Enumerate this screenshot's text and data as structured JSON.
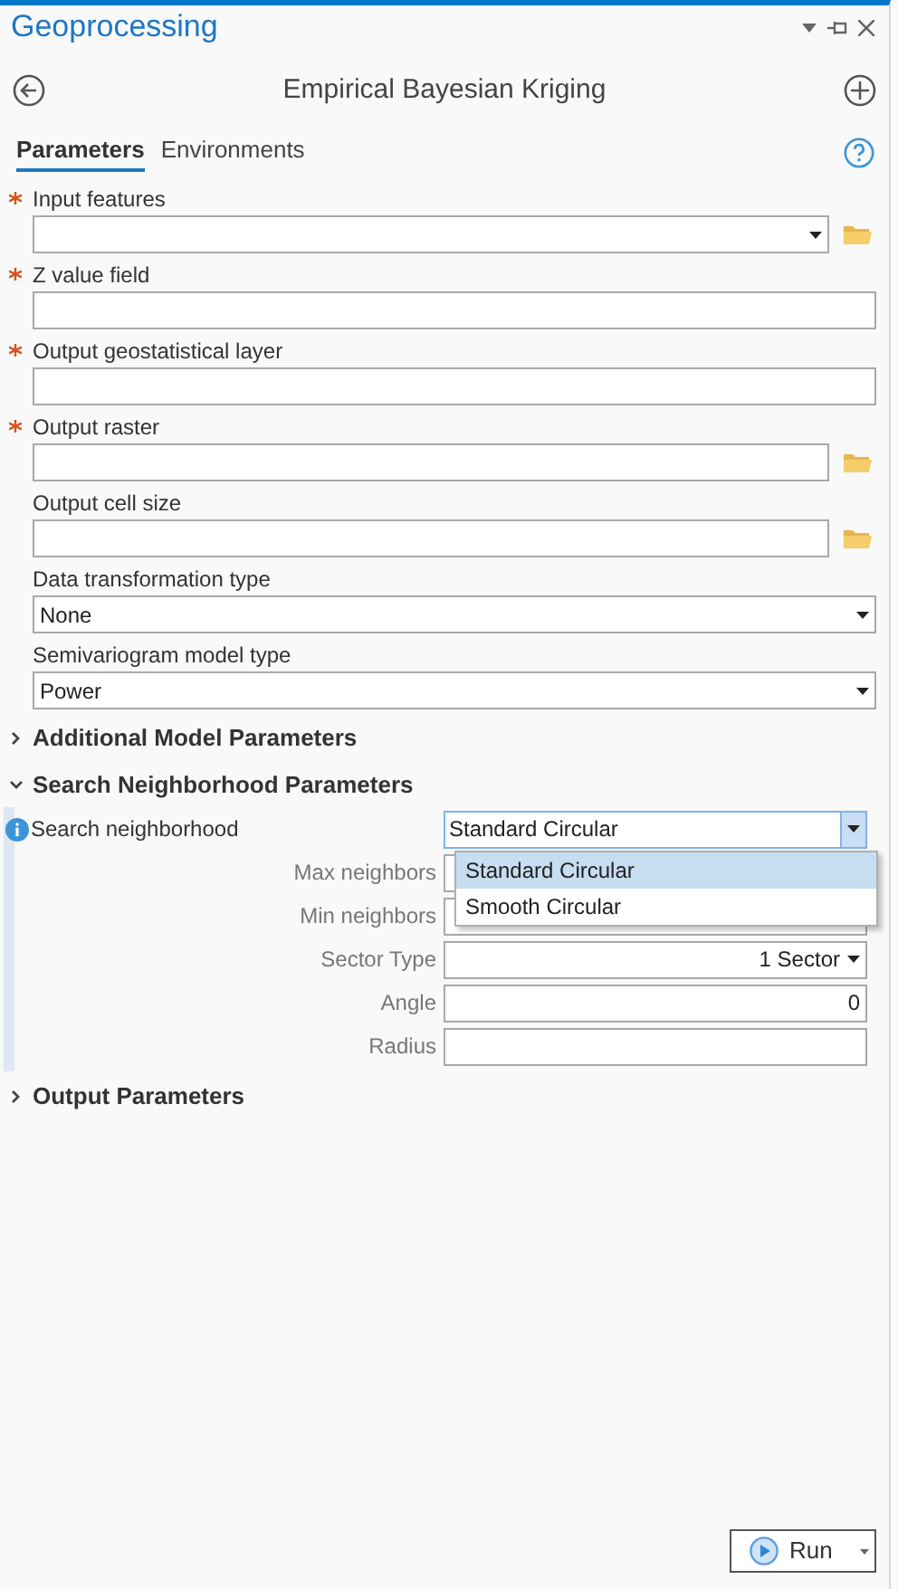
{
  "window": {
    "title": "Geoprocessing"
  },
  "tool": {
    "title": "Empirical Bayesian Kriging"
  },
  "tabs": [
    {
      "label": "Parameters",
      "selected": true
    },
    {
      "label": "Environments",
      "selected": false
    }
  ],
  "parameters": [
    {
      "label": "Input features",
      "required": true,
      "kind": "dropdown",
      "browse": true
    },
    {
      "label": "Z value field",
      "required": true,
      "kind": "text",
      "browse": false
    },
    {
      "label": "Output geostatistical layer",
      "required": true,
      "kind": "text",
      "browse": false
    },
    {
      "label": "Output raster",
      "required": true,
      "kind": "text",
      "browse": true
    },
    {
      "label": "Output cell size",
      "required": false,
      "kind": "text",
      "browse": true
    },
    {
      "label": "Data transformation type",
      "required": false,
      "kind": "dropdown",
      "browse": false,
      "value": "None"
    },
    {
      "label": "Semivariogram model type",
      "required": false,
      "kind": "dropdown",
      "browse": false,
      "value": "Power"
    }
  ],
  "sections": [
    {
      "title": "Additional Model Parameters",
      "expanded": false
    },
    {
      "title": "Search Neighborhood Parameters",
      "expanded": true,
      "search_neighborhood": {
        "label": "Search neighborhood",
        "value": "Standard Circular",
        "options": [
          {
            "label": "Standard Circular",
            "selected": true
          },
          {
            "label": "Smooth Circular",
            "selected": false
          }
        ]
      },
      "rows": [
        {
          "label": "Max neighbors",
          "kind": "text"
        },
        {
          "label": "Min neighbors",
          "kind": "text"
        },
        {
          "label": "Sector Type",
          "kind": "dropdown",
          "value": "1 Sector"
        },
        {
          "label": "Angle",
          "kind": "text",
          "value": "0"
        },
        {
          "label": "Radius",
          "kind": "text"
        }
      ]
    },
    {
      "title": "Output Parameters",
      "expanded": false
    }
  ],
  "run_button": {
    "label": "Run"
  }
}
